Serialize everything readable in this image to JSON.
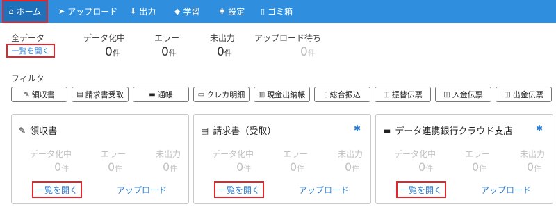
{
  "nav": {
    "items": [
      {
        "label": "ホーム",
        "icon": "home-icon",
        "glyph": "⌂"
      },
      {
        "label": "アップロード",
        "icon": "send-icon",
        "glyph": "➤"
      },
      {
        "label": "出力",
        "icon": "download-icon",
        "glyph": "⬇"
      },
      {
        "label": "学習",
        "icon": "graduation-cap-icon",
        "glyph": "◆"
      },
      {
        "label": "設定",
        "icon": "gear-icon",
        "glyph": "✱"
      },
      {
        "label": "ゴミ箱",
        "icon": "trash-icon",
        "glyph": "▯"
      }
    ]
  },
  "summary": {
    "all_label": "全データ",
    "open_link": "一覧を開く",
    "stats": [
      {
        "label": "データ化中",
        "value": "0",
        "unit": "件"
      },
      {
        "label": "エラー",
        "value": "0",
        "unit": "件"
      },
      {
        "label": "未出力",
        "value": "0",
        "unit": "件"
      },
      {
        "label": "アップロード待ち",
        "value": "0",
        "unit": "件"
      }
    ]
  },
  "filter": {
    "label": "フィルタ",
    "buttons": [
      {
        "label": "領収書",
        "icon": "receipt-icon",
        "glyph": "✎"
      },
      {
        "label": "請求書受取",
        "icon": "invoice-icon",
        "glyph": "▤"
      },
      {
        "label": "通帳",
        "icon": "bankbook-icon",
        "glyph": "▬"
      },
      {
        "label": "クレカ明細",
        "icon": "credit-card-icon",
        "glyph": "▭"
      },
      {
        "label": "現金出納帳",
        "icon": "cashbook-icon",
        "glyph": "▥"
      },
      {
        "label": "総合振込",
        "icon": "transfer-icon",
        "glyph": "▯"
      },
      {
        "label": "振替伝票",
        "icon": "voucher-icon",
        "glyph": "◫"
      },
      {
        "label": "入金伝票",
        "icon": "deposit-voucher-icon",
        "glyph": "◫"
      },
      {
        "label": "出金伝票",
        "icon": "withdrawal-voucher-icon",
        "glyph": "◫"
      }
    ]
  },
  "cards": [
    {
      "title": "領収書",
      "icon": "receipt-icon",
      "glyph": "✎",
      "has_gear": false,
      "stats": [
        {
          "label": "データ化中",
          "value": "0",
          "unit": "件"
        },
        {
          "label": "エラー",
          "value": "0",
          "unit": "件"
        },
        {
          "label": "未出力",
          "value": "0",
          "unit": "件"
        }
      ],
      "open_label": "一覧を開く",
      "upload_label": "アップロード"
    },
    {
      "title": "請求書（受取）",
      "icon": "invoice-icon",
      "glyph": "▤",
      "has_gear": true,
      "stats": [
        {
          "label": "データ化中",
          "value": "0",
          "unit": "件"
        },
        {
          "label": "エラー",
          "value": "0",
          "unit": "件"
        },
        {
          "label": "未出力",
          "value": "0",
          "unit": "件"
        }
      ],
      "open_label": "一覧を開く",
      "upload_label": "アップロード"
    },
    {
      "title": "データ連携銀行クラウド支店",
      "icon": "bankbook-icon",
      "glyph": "▬",
      "has_gear": true,
      "stats": [
        {
          "label": "データ化中",
          "value": "0",
          "unit": "件"
        },
        {
          "label": "エラー",
          "value": "0",
          "unit": "件"
        },
        {
          "label": "未出力",
          "value": "0",
          "unit": "件"
        }
      ],
      "open_label": "一覧を開く",
      "upload_label": "アップロード"
    }
  ],
  "colors": {
    "nav": "#2f8fde",
    "nav_active": "#1f72b9",
    "highlight": "#e3262b",
    "link": "#2b7ed6"
  }
}
